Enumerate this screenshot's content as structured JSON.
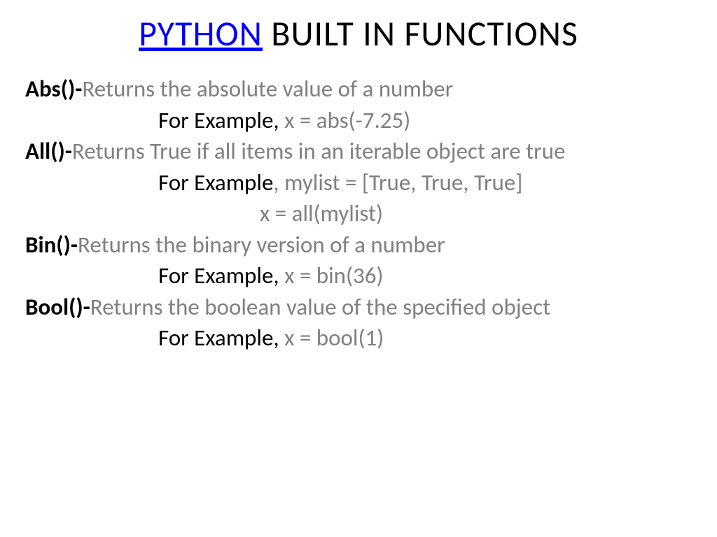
{
  "title": {
    "link": "PYTHON",
    "rest": " BUILT IN FUNCTIONS"
  },
  "functions": [
    {
      "name": "Abs()-",
      "desc": "Returns the absolute value of a number",
      "example_label": "For Example, ",
      "example_code": "x = abs(-7.25)"
    },
    {
      "name": "All()-",
      "desc": "Returns True if all items in an iterable object are true",
      "example_label": "For Example",
      "example_code": ", mylist = [True, True, True]",
      "example_code2": "x = all(mylist)"
    },
    {
      "name": "Bin()-",
      "desc": "Returns the binary version of a number",
      "example_label": "For Example, ",
      "example_code": "x = bin(36)"
    },
    {
      "name": "Bool()-",
      "desc": "Returns the boolean value of the specified object",
      "example_label": "For Example, ",
      "example_code": "x = bool(1)"
    }
  ]
}
